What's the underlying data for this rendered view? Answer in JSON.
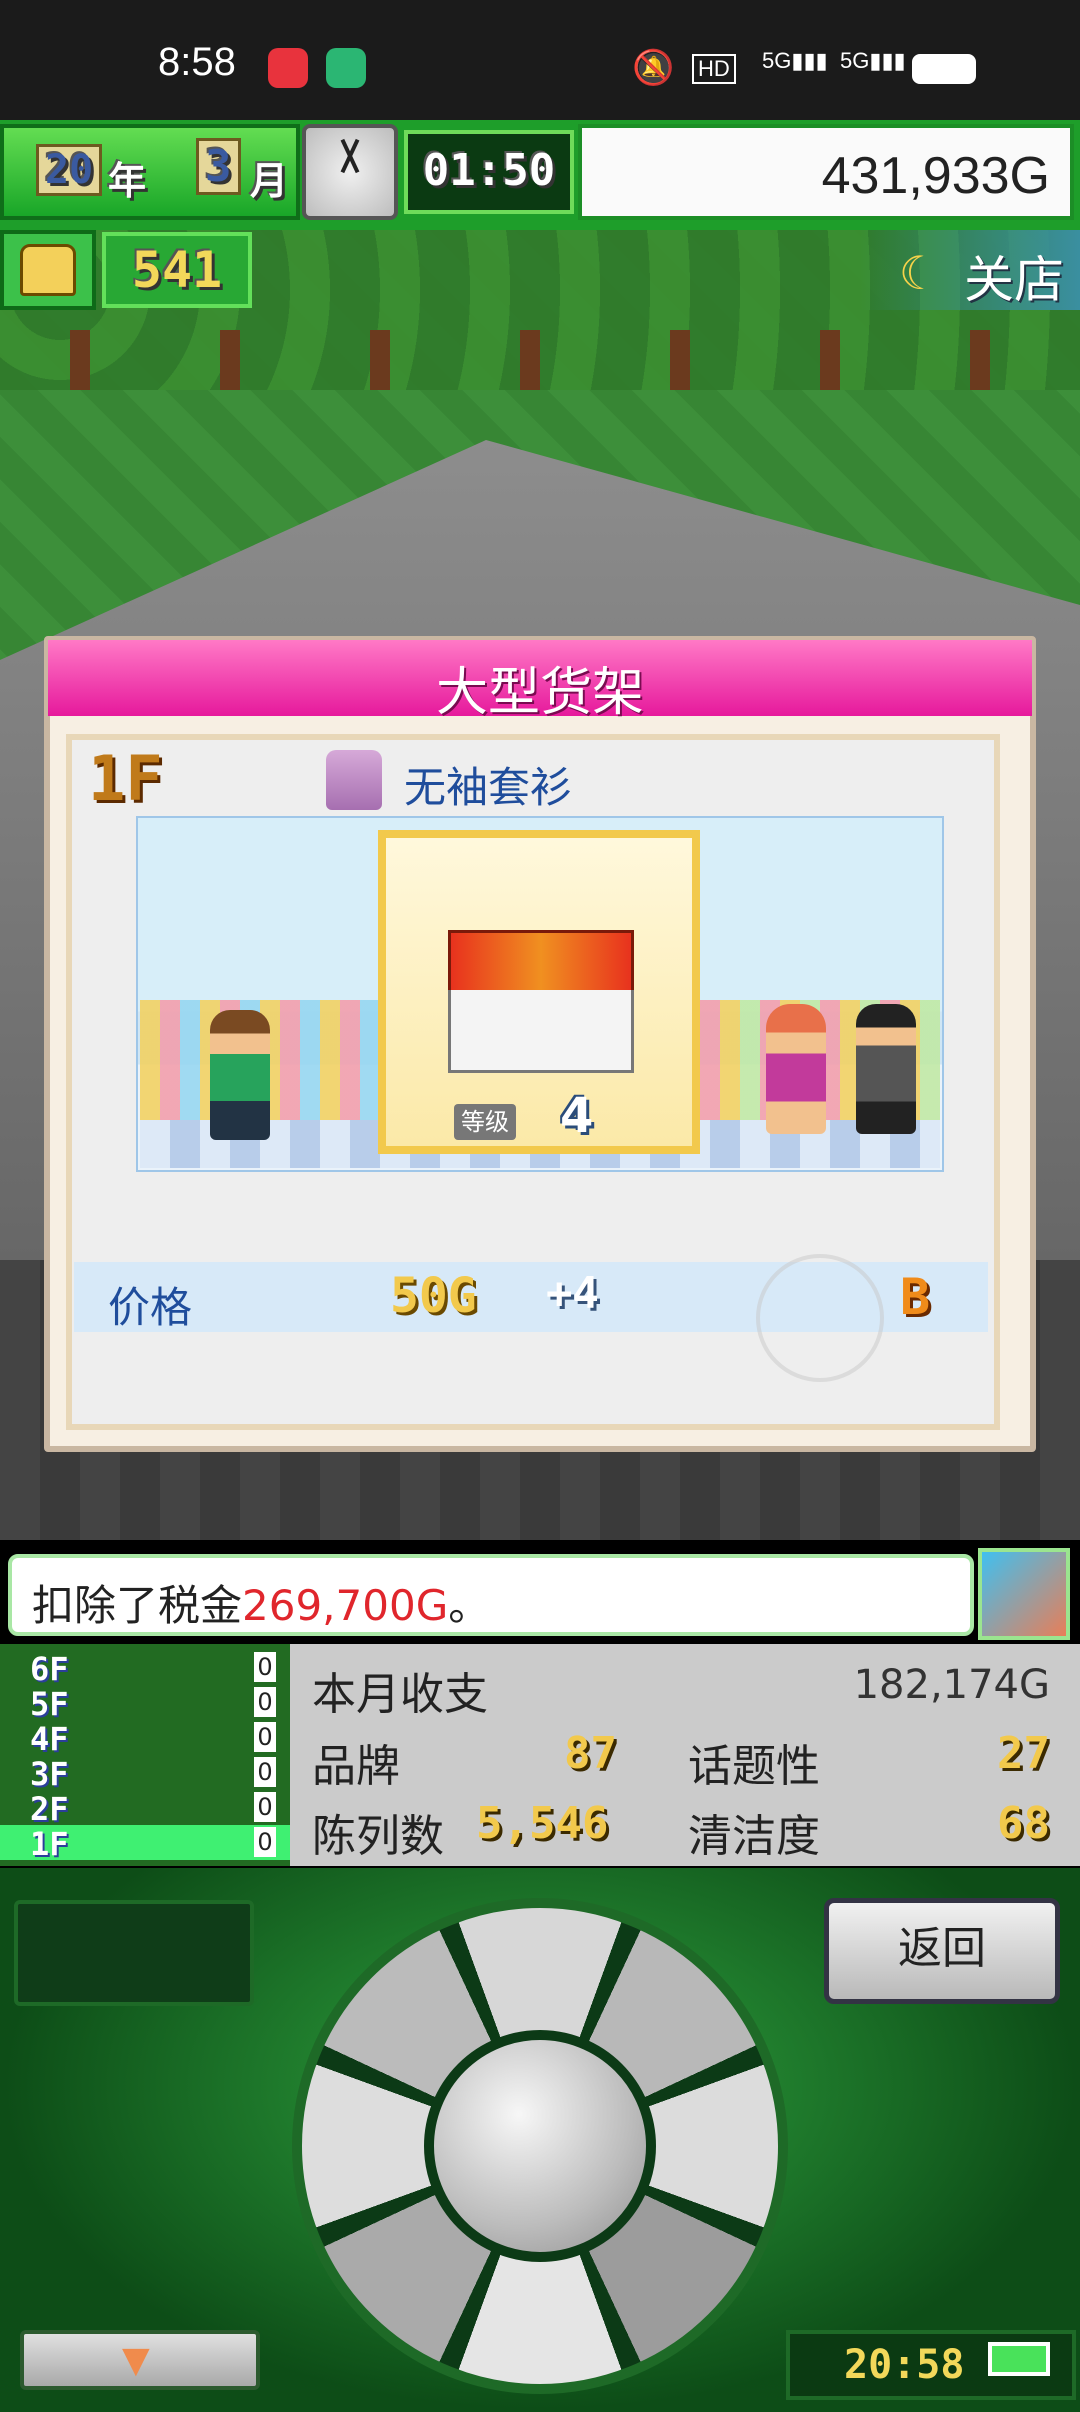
{
  "status_bar": {
    "time": "8:58",
    "icons": [
      "netease-music-icon",
      "vegas-app-icon",
      "mute-icon",
      "hd-icon",
      "5g-signal-icon",
      "5g-signal-icon",
      "battery-icon"
    ]
  },
  "hud": {
    "year": "20",
    "year_unit": "年",
    "month": "3",
    "month_unit": "月",
    "game_time": "01:50",
    "money": "431,933G",
    "shirt_count": "541",
    "shop_status": "关店"
  },
  "dialog": {
    "title": "大型货架",
    "floor": "1F",
    "category": "无袖套衫",
    "level_tag": "等级",
    "level": "4",
    "price_label": "价格",
    "price": "50G",
    "price_bonus": "+4",
    "rank": "B"
  },
  "message": {
    "prefix": "扣除了税金",
    "amount": "269,700G",
    "suffix": "。"
  },
  "floors": [
    {
      "label": "6F",
      "count": "0"
    },
    {
      "label": "5F",
      "count": "0"
    },
    {
      "label": "4F",
      "count": "0"
    },
    {
      "label": "3F",
      "count": "0"
    },
    {
      "label": "2F",
      "count": "0"
    },
    {
      "label": "1F",
      "count": "0"
    }
  ],
  "stats": {
    "monthly_label": "本月收支",
    "monthly_value": "182,174G",
    "brand_label": "品牌",
    "brand_value": "87",
    "topic_label": "话题性",
    "topic_value": "27",
    "display_label": "陈列数",
    "display_value": "5,546",
    "clean_label": "清洁度",
    "clean_value": "68"
  },
  "controls": {
    "back_label": "返回",
    "device_time": "20:58"
  },
  "colors": {
    "accent_green": "#1e9e2a",
    "title_pink": "#e6199c",
    "money_red": "#e0262c",
    "gold": "#f2c94c"
  }
}
